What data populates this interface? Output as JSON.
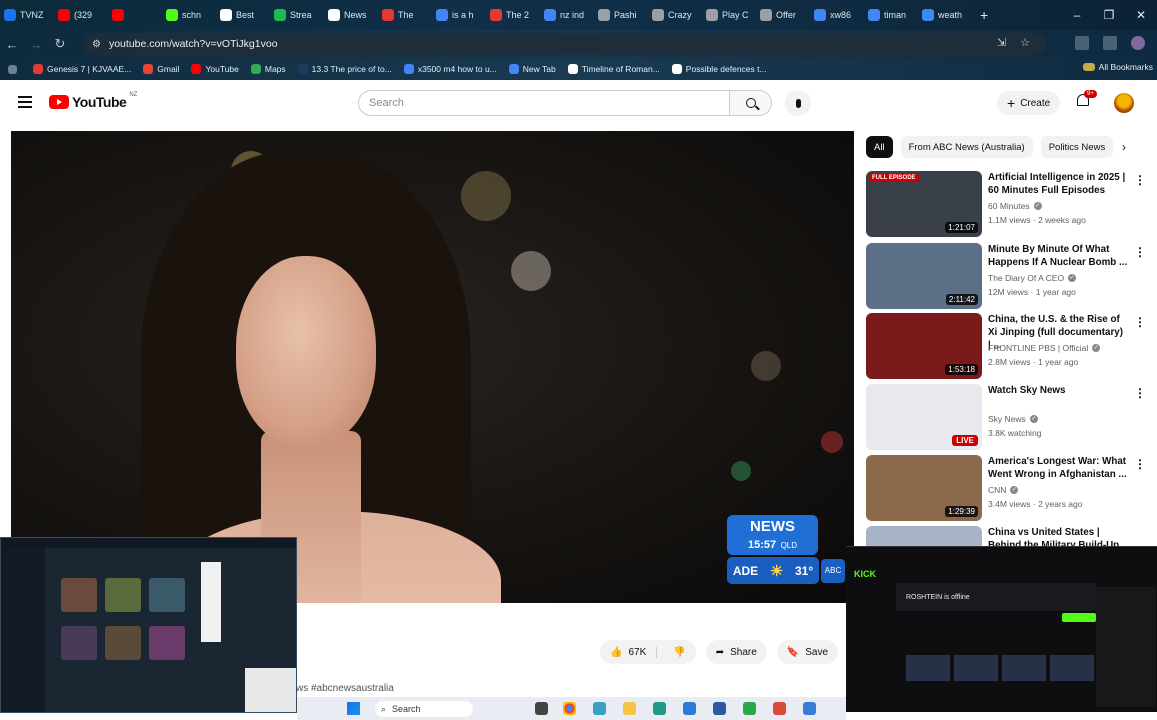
{
  "browser": {
    "tabs": [
      {
        "label": "TVNZ",
        "color": "#1a73e8"
      },
      {
        "label": "(329",
        "color": "#ff0000"
      },
      {
        "label": "",
        "color": "#ff0000"
      },
      {
        "label": "schn",
        "color": "#53fc18"
      },
      {
        "label": "Best",
        "color": "#ffffff"
      },
      {
        "label": "Strea",
        "color": "#1db954"
      },
      {
        "label": "News",
        "color": "#ffffff"
      },
      {
        "label": "The",
        "color": "#e53935"
      },
      {
        "label": "is a h",
        "color": "#4285f4"
      },
      {
        "label": "The 2",
        "color": "#e53935"
      },
      {
        "label": "nz ind",
        "color": "#4285f4"
      },
      {
        "label": "Pashi",
        "color": "#9aa0a6"
      },
      {
        "label": "Crazy",
        "color": "#9aa0a6"
      },
      {
        "label": "Play C",
        "color": "#9aa0a6"
      },
      {
        "label": "Offer",
        "color": "#9aa0a6"
      },
      {
        "label": "xw86",
        "color": "#4285f4"
      },
      {
        "label": "timan",
        "color": "#4285f4"
      },
      {
        "label": "weath",
        "color": "#4285f4"
      }
    ],
    "new_tab": "+",
    "window_controls": {
      "minimize": "–",
      "maximize": "❐",
      "close": "✕"
    },
    "url": "youtube.com/watch?v=vOTiJkg1voo",
    "bookmarks": [
      {
        "label": "Genesis 7 | KJVAAE...",
        "color": "#e53935"
      },
      {
        "label": "Gmail",
        "color": "#ea4335"
      },
      {
        "label": "YouTube",
        "color": "#ff0000"
      },
      {
        "label": "Maps",
        "color": "#34a853"
      },
      {
        "label": "13.3 The price of to...",
        "color": "#1e3a5f"
      },
      {
        "label": "x3500 m4 how to u...",
        "color": "#4285f4"
      },
      {
        "label": "New Tab",
        "color": "#4285f4"
      },
      {
        "label": "Timeline of Roman...",
        "color": "#ffffff"
      },
      {
        "label": "Possible defences t...",
        "color": "#ffffff"
      }
    ],
    "all_bookmarks": "All Bookmarks"
  },
  "youtube": {
    "logo_text": "YouTube",
    "region": "NZ",
    "search_placeholder": "Search",
    "create_label": "Create",
    "notifications_badge": "9+"
  },
  "player": {
    "news_brand": "NEWS",
    "news_time": "15:57",
    "news_tz": "QLD",
    "weather_city": "ADE",
    "weather_temp": "31°",
    "abc_logo": "ABC"
  },
  "actions": {
    "likes": "67K",
    "share": "Share",
    "save": "Save",
    "more": "···"
  },
  "description_snippet": "ws #abcnewsaustralia",
  "chips": [
    "All",
    "From ABC News (Australia)",
    "Politics News"
  ],
  "recommendations": [
    {
      "title": "Artificial Intelligence in 2025 | 60 Minutes Full Episodes",
      "channel": "60 Minutes",
      "meta": "1.1M views · 2 weeks ago",
      "duration": "1:21:07",
      "tag": "FULL EPISODE",
      "thumb": "#3a4048"
    },
    {
      "title": "Minute By Minute Of What Happens If A Nuclear Bomb ...",
      "channel": "The Diary Of A CEO",
      "meta": "12M views · 1 year ago",
      "duration": "2:11:42",
      "tag": "",
      "thumb": "#5b6f86"
    },
    {
      "title": "China, the U.S. & the Rise of Xi Jinping (full documentary) | ...",
      "channel": "FRONTLINE PBS | Official",
      "meta": "2.8M views · 1 year ago",
      "duration": "1:53:18",
      "tag": "",
      "thumb": "#7a1a1a"
    },
    {
      "title": "Watch Sky News",
      "channel": "Sky News",
      "meta": "3.8K watching",
      "duration": "LIVE",
      "tag": "",
      "thumb": "#e8e9ee"
    },
    {
      "title": "America's Longest War: What Went Wrong in Afghanistan ...",
      "channel": "CNN",
      "meta": "3.4M views · 2 years ago",
      "duration": "1:29:39",
      "tag": "",
      "thumb": "#8a6a4a"
    },
    {
      "title": "China vs United States | Behind the Military Build-Up ...",
      "channel": "",
      "meta": "",
      "duration": "",
      "tag": "",
      "thumb": "#a7b4c6"
    }
  ],
  "overlay_right": {
    "brand": "KICK",
    "offline_text": "ROSHTEIN is offline"
  },
  "taskbar": {
    "search_label": "Search"
  }
}
